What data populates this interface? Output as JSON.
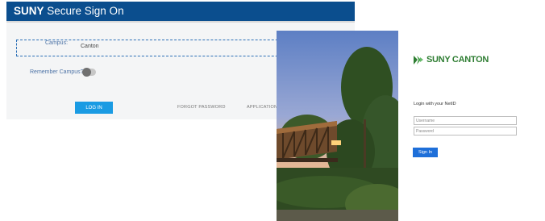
{
  "sso": {
    "title_bold": "SUNY",
    "title_rest": " Secure Sign On",
    "campus_label": "Campus:",
    "campus_value": "Canton",
    "remember_label": "Remember Campus?",
    "remember_on": false,
    "login_label": "LOG IN",
    "forgot_label": "FORGOT PASSWORD",
    "apply_label": "APPLICATION",
    "colors": {
      "header": "#0b4e8e",
      "button": "#1a9be3"
    }
  },
  "canton": {
    "brand_text": "SUNY CANTON",
    "brand_icon": "canton-logo-icon",
    "login_prompt": "Login with your NetID",
    "username_placeholder": "Username",
    "password_placeholder": "Password",
    "signin_label": "Sign In",
    "colors": {
      "brand": "#2e7d32",
      "button": "#1e6fd9"
    }
  }
}
